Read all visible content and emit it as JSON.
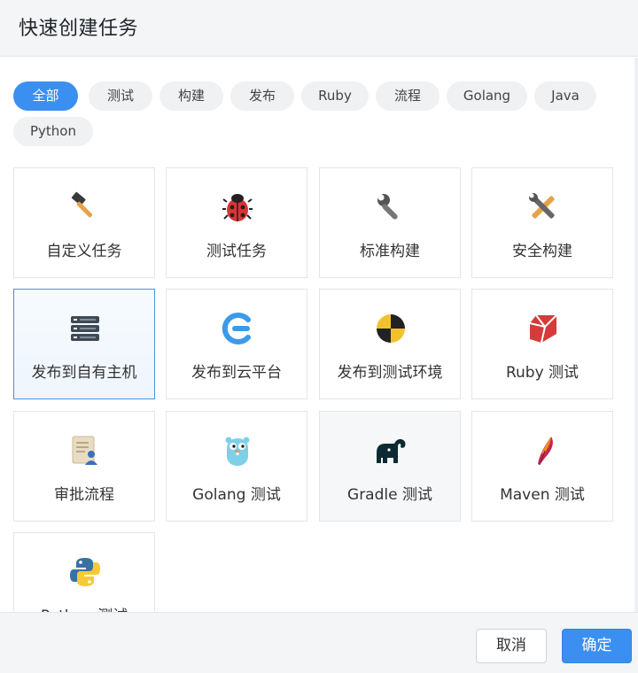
{
  "dialog": {
    "title": "快速创建任务"
  },
  "filters": [
    {
      "label": "全部",
      "active": true
    },
    {
      "label": "测试",
      "active": false
    },
    {
      "label": "构建",
      "active": false
    },
    {
      "label": "发布",
      "active": false
    },
    {
      "label": "Ruby",
      "active": false
    },
    {
      "label": "流程",
      "active": false
    },
    {
      "label": "Golang",
      "active": false
    },
    {
      "label": "Java",
      "active": false
    },
    {
      "label": "Python",
      "active": false
    }
  ],
  "tasks": [
    {
      "label": "自定义任务",
      "icon": "hammer-icon"
    },
    {
      "label": "测试任务",
      "icon": "ladybug-icon"
    },
    {
      "label": "标准构建",
      "icon": "wrench-icon"
    },
    {
      "label": "安全构建",
      "icon": "tools-icon"
    },
    {
      "label": "发布到自有主机",
      "icon": "server-icon"
    },
    {
      "label": "发布到云平台",
      "icon": "cloud-e-icon"
    },
    {
      "label": "发布到测试环境",
      "icon": "test-target-icon"
    },
    {
      "label": "Ruby 测试",
      "icon": "ruby-icon"
    },
    {
      "label": "审批流程",
      "icon": "approval-document-icon"
    },
    {
      "label": "Golang 测试",
      "icon": "gopher-icon"
    },
    {
      "label": "Gradle 测试",
      "icon": "gradle-elephant-icon"
    },
    {
      "label": "Maven 测试",
      "icon": "maven-feather-icon"
    },
    {
      "label": "Python 测试",
      "icon": "python-icon"
    }
  ],
  "footer": {
    "cancel_label": "取消",
    "confirm_label": "确定"
  },
  "colors": {
    "accent": "#3b8ff0",
    "selected_border": "#4a90e2"
  }
}
